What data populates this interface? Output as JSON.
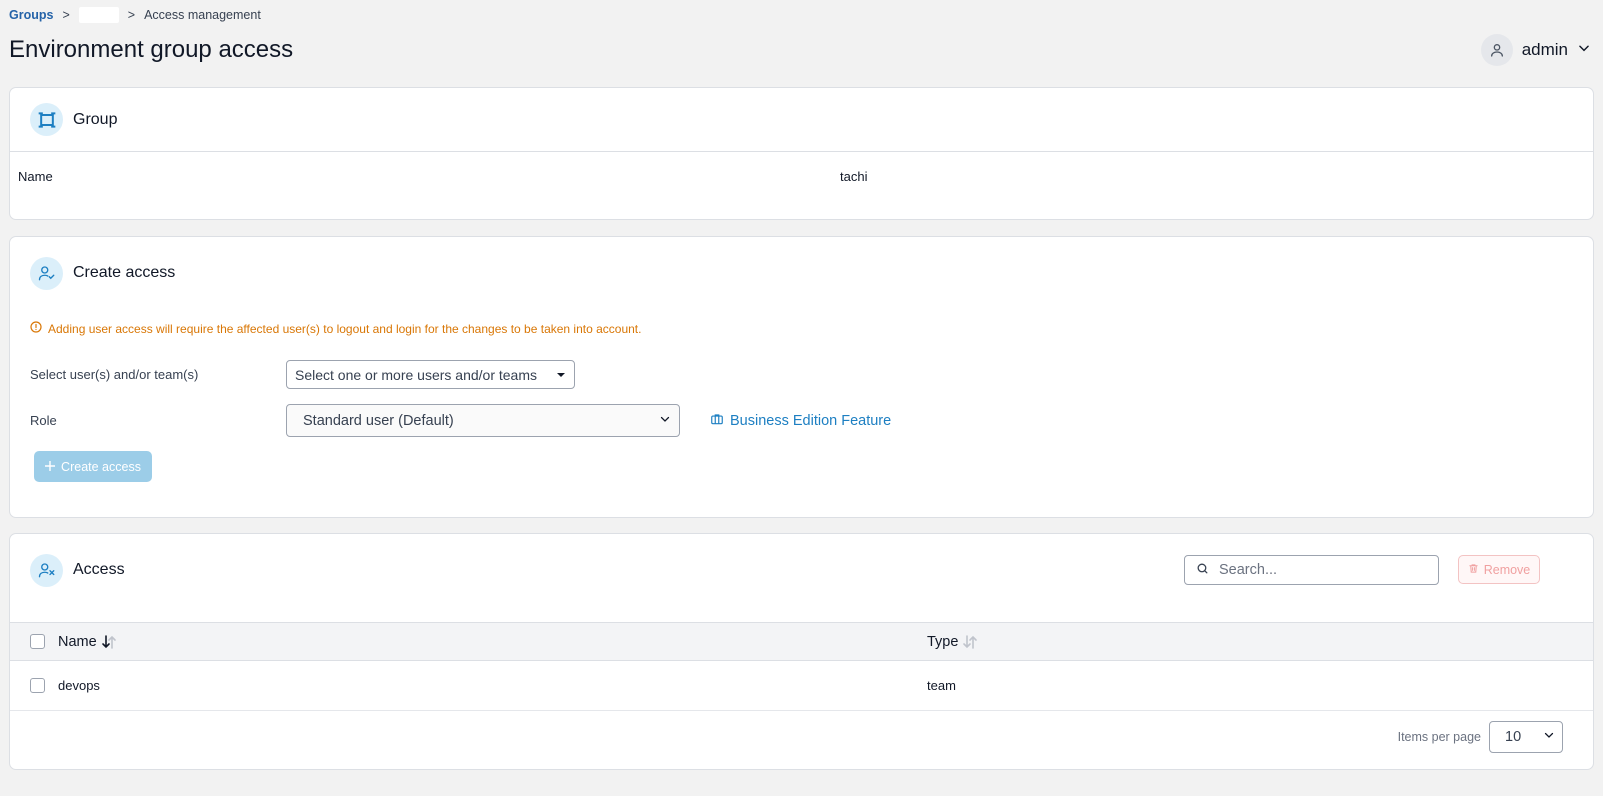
{
  "breadcrumb": {
    "groups": "Groups",
    "sep1": ">",
    "sep2": ">",
    "current": "Access management"
  },
  "page": {
    "title": "Environment group access"
  },
  "user": {
    "name": "admin"
  },
  "group_card": {
    "title": "Group",
    "name_label": "Name",
    "name_value": "tachi"
  },
  "create_card": {
    "title": "Create access",
    "warning": "Adding user access will require the affected user(s) to logout and login for the changes to be taken into account.",
    "users_label": "Select user(s) and/or team(s)",
    "users_placeholder": "Select one or more users and/or teams",
    "role_label": "Role",
    "role_value": "Standard user (Default)",
    "business_link": "Business Edition Feature",
    "create_button": "Create access"
  },
  "access_card": {
    "title": "Access",
    "search_placeholder": "Search...",
    "remove_button": "Remove",
    "columns": {
      "name": "Name",
      "type": "Type"
    },
    "rows": [
      {
        "name": "devops",
        "type": "team"
      }
    ],
    "items_per_page_label": "Items per page",
    "items_per_page_value": "10"
  },
  "colors": {
    "accent": "#1d7fc2",
    "warning": "#d97706",
    "icon_bg": "#dbeffa",
    "remove": "#f0a0a0"
  }
}
